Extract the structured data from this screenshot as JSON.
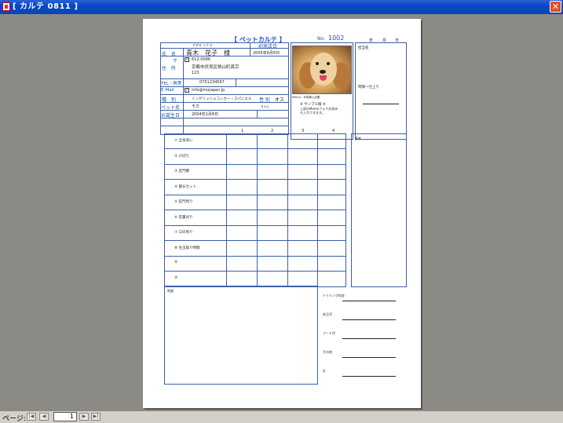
{
  "window": {
    "title": "[ カルテ 0811 ]",
    "close_glyph": "✕"
  },
  "report": {
    "title": "【 ペットカルテ 】",
    "no_label": "No.",
    "no_value": "1002",
    "date_year": "年",
    "date_month": "月",
    "date_day": "日",
    "furigana": "アオキ ハナコ",
    "first_visit_label": "初来店日",
    "first_visit_value": "2005年6月8日",
    "name_label": "氏　名",
    "owner_name": "青木　花子　様",
    "address_label": "住　所",
    "postal_mark": "〒",
    "postal_code": "612-0086",
    "address_line1": "京都市伏見区桃山町真宗",
    "address_line2": "123",
    "tel_label": "TEL・携帯",
    "tel_value": "0751234567",
    "email_label": "E-Mail",
    "email_value": "info@mojapan.jp",
    "breed_label": "種　別",
    "breed_value": "イングリッシュコッカー・スパニエル",
    "sex_label": "性 別",
    "sex_value": "オス",
    "pet_name_label": "ペット名",
    "pet_name_value": "モカ",
    "pet_name_suffix": "ちゃん",
    "birthday_label": "お誕生日",
    "birthday_value": "2004年1月8日",
    "photo_caption": "Memo：写真挿入必要",
    "sample_note1": "※ サンプル版 ※",
    "sample_note2": "上部のMemoフォでお試み",
    "sample_note3": "せ入力できます。",
    "groomer_label": "担当名",
    "time_label": "時間〜仕上り",
    "grid_headers": [
      "1",
      "2",
      "3",
      "4"
    ],
    "grid_rows": [
      "① 全身洗い",
      "② 爪切り",
      "③ 肛門腺",
      "④ 部分カット",
      "⑤ 肛門周り",
      "⑥ 足裏刈り",
      "⑦ 口の周り",
      "⑧ 毛玉取り時間",
      "⑨",
      "⑩"
    ],
    "remarks_label": "備考",
    "map_label": "地図",
    "fee_labels": [
      "トリミング料金",
      "毛玉代",
      "フード代",
      "その他",
      "計"
    ]
  },
  "statusbar": {
    "page_label": "ページ:",
    "page_value": "1",
    "first": "|◀",
    "prev": "◀",
    "next": "▶",
    "last": "▶|"
  }
}
